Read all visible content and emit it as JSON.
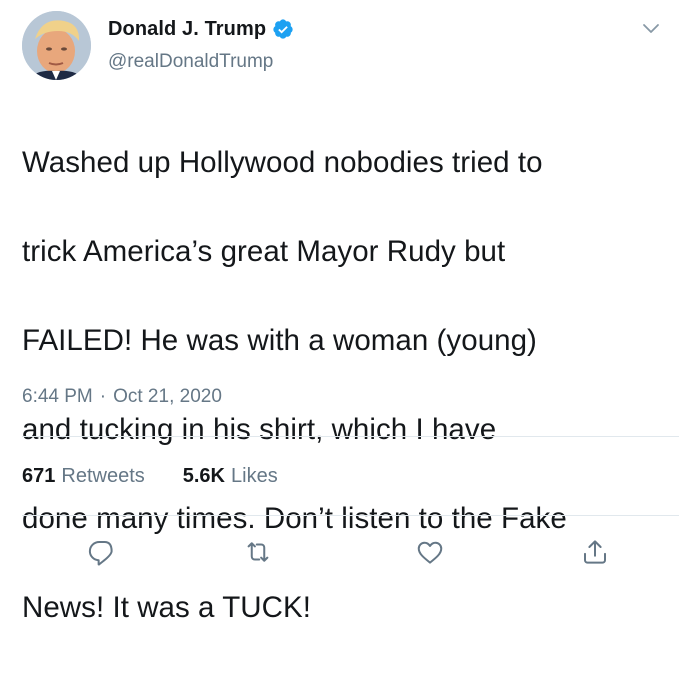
{
  "user": {
    "display_name": "Donald J. Trump",
    "handle": "@realDonaldTrump",
    "verified": true,
    "avatar_icon": "profile-photo"
  },
  "tweet": {
    "lines": [
      "Washed up Hollywood nobodies tried to",
      "trick America’s great Mayor Rudy but",
      "FAILED! He was with a woman (young)",
      "and tucking in his shirt, which I have",
      "done many times. Don’t listen to the Fake",
      "News! It was a TUCK!"
    ]
  },
  "meta": {
    "time": "6:44 PM",
    "separator": "·",
    "date": "Oct 21, 2020"
  },
  "stats": {
    "retweets_count": "671",
    "retweets_label": "Retweets",
    "likes_count": "5.6K",
    "likes_label": "Likes"
  },
  "actions": [
    "reply-icon",
    "retweet-icon",
    "like-icon",
    "share-icon"
  ],
  "colors": {
    "text": "#14171a",
    "secondary": "#657786",
    "divider": "#e1e8ed",
    "verified": "#1da1f2"
  }
}
